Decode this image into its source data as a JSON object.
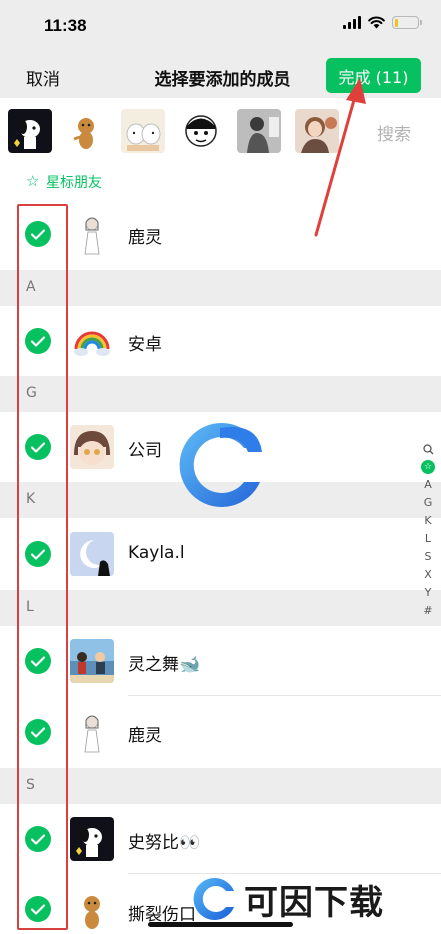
{
  "status_bar": {
    "time": "11:38"
  },
  "nav": {
    "cancel_label": "取消",
    "title": "选择要添加的成员",
    "done_label": "完成 (11)"
  },
  "selected_strip": {
    "search_placeholder": "搜索"
  },
  "starred_section": {
    "label": "星标朋友"
  },
  "index_bar": [
    "A",
    "G",
    "K",
    "L",
    "S",
    "X",
    "Y",
    "#"
  ],
  "contacts": [
    {
      "name": "鹿灵"
    },
    {
      "name": "安卓"
    },
    {
      "name": "公司"
    },
    {
      "name": "Kayla.l"
    },
    {
      "name": "灵之舞🐋"
    },
    {
      "name": "鹿灵"
    },
    {
      "name": "史努比👀"
    },
    {
      "name": "撕裂伤口"
    }
  ],
  "sections": [
    "A",
    "G",
    "K",
    "L",
    "S"
  ],
  "watermark": {
    "brand_text": "可因下载"
  },
  "colors": {
    "accent": "#07c160",
    "highlight": "#d94040",
    "arrow": "#e0403c"
  }
}
